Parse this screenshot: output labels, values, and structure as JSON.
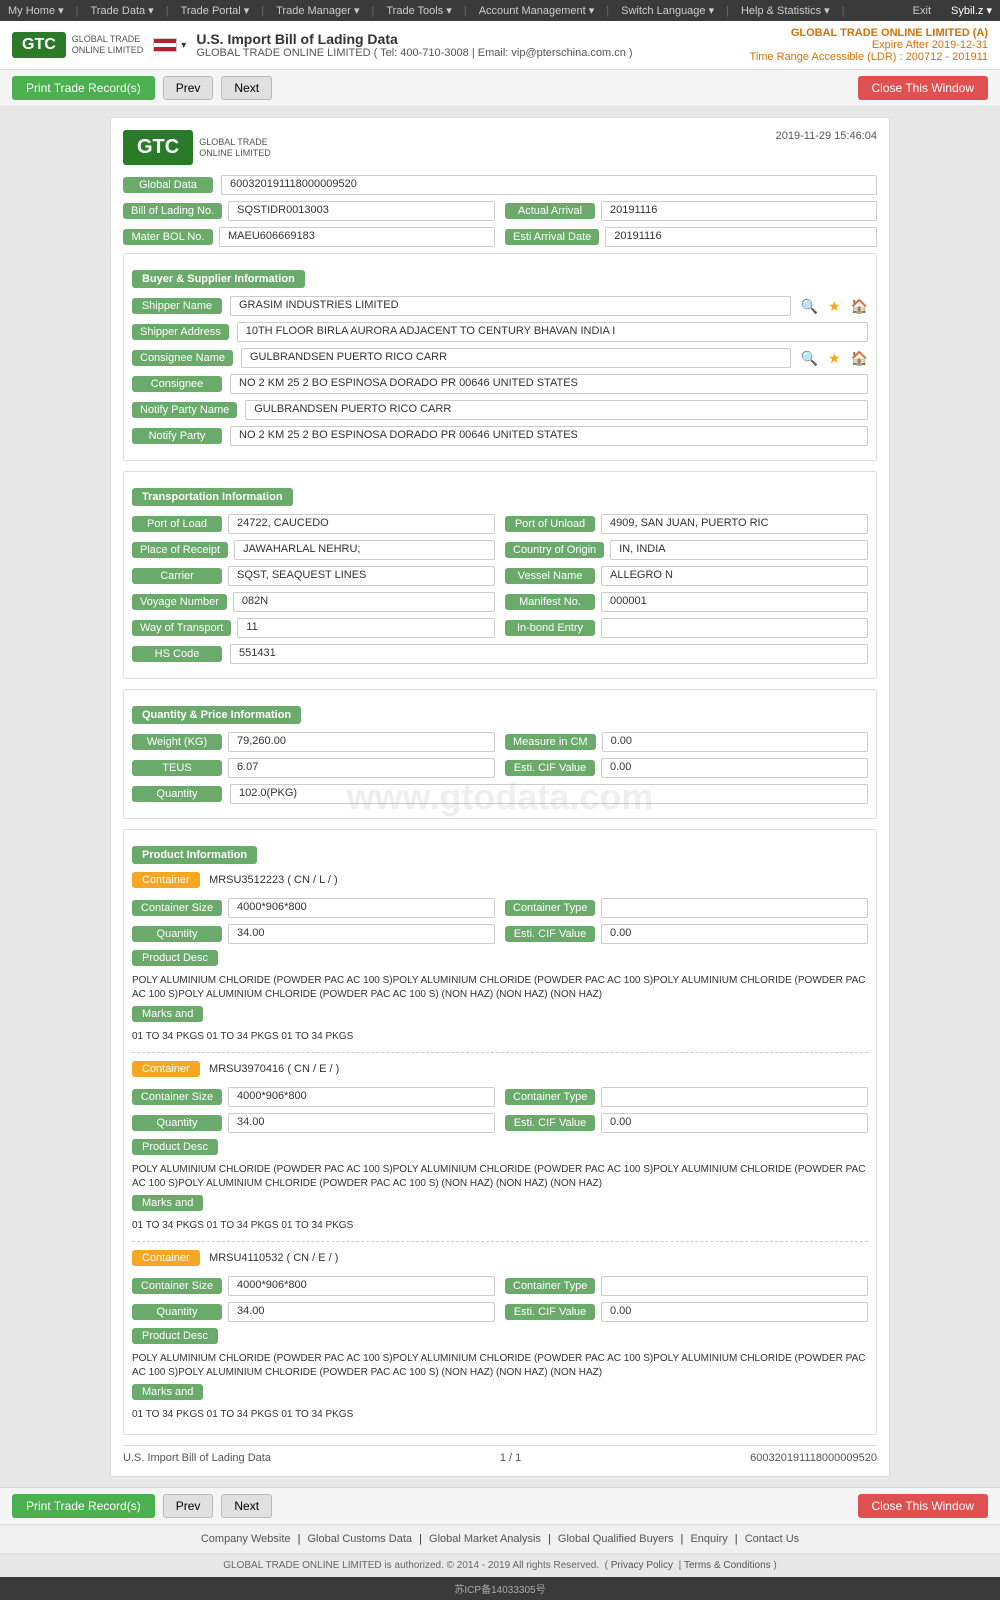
{
  "topnav": {
    "items": [
      "My Home",
      "Trade Data",
      "Trade Portal",
      "Trade Manager",
      "Trade Tools",
      "Account Management",
      "Switch Language",
      "Help & Statistics",
      "Exit"
    ],
    "user": "Sybil.z"
  },
  "header": {
    "logo_text": "GTC",
    "logo_sub": "GLOBAL TRADE ONLINE LIMITED",
    "title": "U.S. Import Bill of Lading Data",
    "subtitle": "GLOBAL TRADE ONLINE LIMITED ( Tel: 400-710-3008 | Email: vip@pterschina.com.cn )",
    "account_name": "GLOBAL TRADE ONLINE LIMITED (A)",
    "expire": "Expire After 2019-12-31",
    "time_range": "Time Range Accessible (LDR) : 200712 - 201911"
  },
  "toolbar": {
    "print_label": "Print Trade Record(s)",
    "prev_label": "Prev",
    "next_label": "Next",
    "close_label": "Close This Window"
  },
  "record": {
    "timestamp": "2019-11-29 15:46:04",
    "global_data_label": "Global Data",
    "global_data_value": "600320191118000009520",
    "fields": {
      "bol_no_label": "Bill of Lading No.",
      "bol_no_value": "SQSTIDR0013003",
      "actual_arrival_label": "Actual Arrival",
      "actual_arrival_value": "20191116",
      "mater_bol_label": "Mater BOL No.",
      "mater_bol_value": "MAEU606669183",
      "esti_arrival_label": "Esti Arrival Date",
      "esti_arrival_value": "20191116"
    },
    "buyer_supplier": {
      "section_label": "Buyer & Supplier Information",
      "shipper_name_label": "Shipper Name",
      "shipper_name_value": "GRASIM INDUSTRIES LIMITED",
      "shipper_address_label": "Shipper Address",
      "shipper_address_value": "10TH FLOOR BIRLA AURORA ADJACENT TO CENTURY BHAVAN INDIA I",
      "consignee_name_label": "Consignee Name",
      "consignee_name_value": "GULBRANDSEN PUERTO RICO CARR",
      "consignee_label": "Consignee",
      "consignee_value": "NO 2 KM 25 2 BO ESPINOSA DORADO PR 00646 UNITED STATES",
      "notify_party_name_label": "Notify Party Name",
      "notify_party_name_value": "GULBRANDSEN PUERTO RICO CARR",
      "notify_party_label": "Notify Party",
      "notify_party_value": "NO 2 KM 25 2 BO ESPINOSA DORADO PR 00646 UNITED STATES"
    },
    "transportation": {
      "section_label": "Transportation Information",
      "port_of_load_label": "Port of Load",
      "port_of_load_value": "24722, CAUCEDO",
      "port_of_unload_label": "Port of Unload",
      "port_of_unload_value": "4909, SAN JUAN, PUERTO RIC",
      "place_of_receipt_label": "Place of Receipt",
      "place_of_receipt_value": "JAWAHARLAL NEHRU;",
      "country_of_origin_label": "Country of Origin",
      "country_of_origin_value": "IN, INDIA",
      "carrier_label": "Carrier",
      "carrier_value": "SQST, SEAQUEST LINES",
      "vessel_name_label": "Vessel Name",
      "vessel_name_value": "ALLEGRO N",
      "voyage_number_label": "Voyage Number",
      "voyage_number_value": "082N",
      "manifest_no_label": "Manifest No.",
      "manifest_no_value": "000001",
      "way_of_transport_label": "Way of Transport",
      "way_of_transport_value": "11",
      "in_bond_entry_label": "In-bond Entry",
      "in_bond_entry_value": "",
      "hs_code_label": "HS Code",
      "hs_code_value": "551431"
    },
    "quantity_price": {
      "section_label": "Quantity & Price Information",
      "weight_label": "Weight (KG)",
      "weight_value": "79,260.00",
      "measure_cm_label": "Measure in CM",
      "measure_cm_value": "0.00",
      "teus_label": "TEUS",
      "teus_value": "6.07",
      "esti_cif_label": "Esti. CIF Value",
      "esti_cif_value": "0.00",
      "quantity_label": "Quantity",
      "quantity_value": "102.0(PKG)"
    },
    "product_info": {
      "section_label": "Product Information",
      "containers": [
        {
          "container_label": "Container",
          "container_value": "MRSU3512223 ( CN / L / )",
          "size_label": "Container Size",
          "size_value": "4000*906*800",
          "type_label": "Container Type",
          "type_value": "",
          "quantity_label": "Quantity",
          "quantity_value": "34.00",
          "esti_cif_label": "Esti. CIF Value",
          "esti_cif_value": "0.00",
          "product_desc_label": "Product Desc",
          "product_desc": "POLY ALUMINIUM CHLORIDE (POWDER PAC AC 100 S)POLY ALUMINIUM CHLORIDE (POWDER PAC AC 100 S)POLY ALUMINIUM CHLORIDE (POWDER PAC AC 100 S)POLY ALUMINIUM CHLORIDE (POWDER PAC AC 100 S) (NON HAZ) (NON HAZ) (NON HAZ)",
          "marks_label": "Marks and",
          "marks_value": "01 TO 34 PKGS 01 TO 34 PKGS 01 TO 34 PKGS"
        },
        {
          "container_label": "Container",
          "container_value": "MRSU3970416 ( CN / E / )",
          "size_label": "Container Size",
          "size_value": "4000*906*800",
          "type_label": "Container Type",
          "type_value": "",
          "quantity_label": "Quantity",
          "quantity_value": "34.00",
          "esti_cif_label": "Esti. CIF Value",
          "esti_cif_value": "0.00",
          "product_desc_label": "Product Desc",
          "product_desc": "POLY ALUMINIUM CHLORIDE (POWDER PAC AC 100 S)POLY ALUMINIUM CHLORIDE (POWDER PAC AC 100 S)POLY ALUMINIUM CHLORIDE (POWDER PAC AC 100 S)POLY ALUMINIUM CHLORIDE (POWDER PAC AC 100 S) (NON HAZ) (NON HAZ) (NON HAZ)",
          "marks_label": "Marks and",
          "marks_value": "01 TO 34 PKGS 01 TO 34 PKGS 01 TO 34 PKGS"
        },
        {
          "container_label": "Container",
          "container_value": "MRSU4110532 ( CN / E / )",
          "size_label": "Container Size",
          "size_value": "4000*906*800",
          "type_label": "Container Type",
          "type_value": "",
          "quantity_label": "Quantity",
          "quantity_value": "34.00",
          "esti_cif_label": "Esti. CIF Value",
          "esti_cif_value": "0.00",
          "product_desc_label": "Product Desc",
          "product_desc": "POLY ALUMINIUM CHLORIDE (POWDER PAC AC 100 S)POLY ALUMINIUM CHLORIDE (POWDER PAC AC 100 S)POLY ALUMINIUM CHLORIDE (POWDER PAC AC 100 S)POLY ALUMINIUM CHLORIDE (POWDER PAC AC 100 S) (NON HAZ) (NON HAZ) (NON HAZ)",
          "marks_label": "Marks and",
          "marks_value": "01 TO 34 PKGS 01 TO 34 PKGS 01 TO 34 PKGS"
        }
      ]
    },
    "footer": {
      "left": "U.S. Import Bill of Lading Data",
      "page": "1 / 1",
      "record_id": "600320191118000009520"
    }
  },
  "footer": {
    "links": [
      "Company Website",
      "Global Customs Data",
      "Global Market Analysis",
      "Global Qualified Buyers",
      "Enquiry",
      "Contact Us"
    ],
    "copyright": "GLOBAL TRADE ONLINE LIMITED is authorized. © 2014 - 2019 All rights Reserved.",
    "privacy": "Privacy Policy",
    "terms": "Terms & Conditions",
    "icp": "苏ICP备14033305号"
  },
  "watermark": "www.gtodata.com"
}
